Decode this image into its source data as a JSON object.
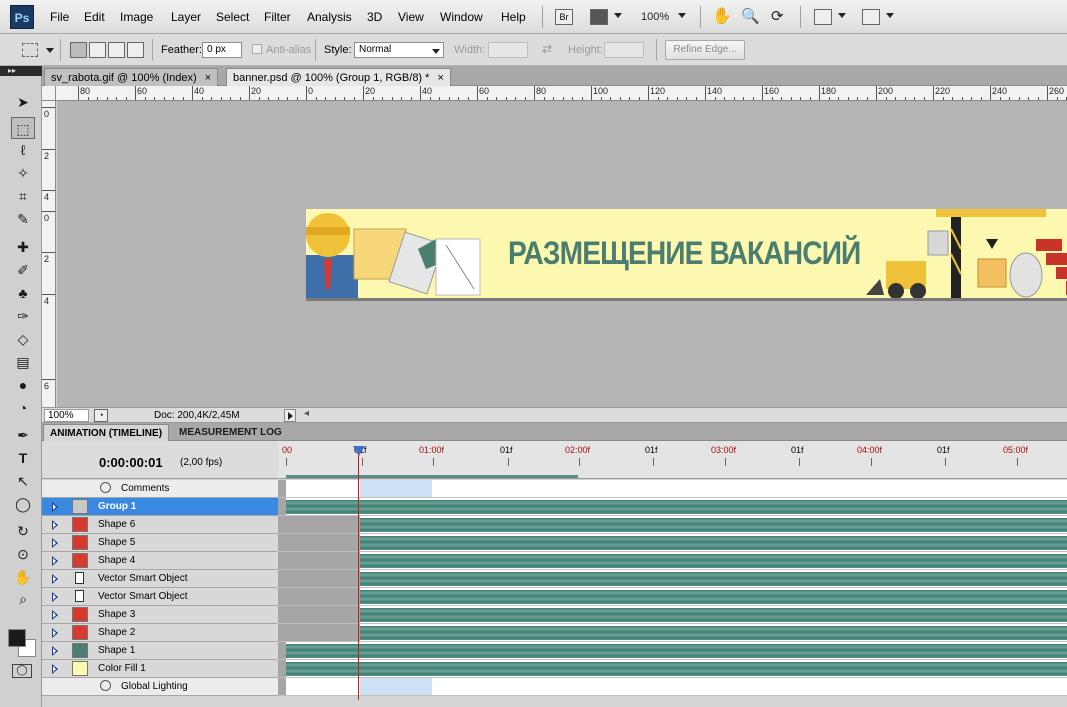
{
  "app": {
    "logo": "Ps",
    "accent": "#3a89e0"
  },
  "menu": [
    "File",
    "Edit",
    "Image",
    "Layer",
    "Select",
    "Filter",
    "Analysis",
    "3D",
    "View",
    "Window",
    "Help"
  ],
  "menubar_tools": {
    "bridge_label": "Br",
    "zoom": "100%"
  },
  "options": {
    "feather_label": "Feather:",
    "feather_value": "0 px",
    "antialias_label": "Anti-alias",
    "style_label": "Style:",
    "style_value": "Normal",
    "width_label": "Width:",
    "height_label": "Height:",
    "refine_label": "Refine Edge..."
  },
  "tabs": [
    {
      "label": "sv_rabota.gif @ 100% (Index)",
      "close": "×"
    },
    {
      "label": "banner.psd @ 100% (Group 1, RGB/8) *",
      "close": "×"
    }
  ],
  "ruler_h": [
    "80",
    "60",
    "40",
    "20",
    "0",
    "20",
    "40",
    "60",
    "80",
    "100",
    "120",
    "140",
    "160",
    "180",
    "200",
    "220",
    "240",
    "260"
  ],
  "ruler_v": [
    "0",
    "2",
    "4",
    "0",
    "2",
    "4",
    "6"
  ],
  "banner": {
    "text": "РАЗМЕЩЕНИЕ ВАКАНСИЙ",
    "text_color": "#4b7d70",
    "bg": "#fdf8b0"
  },
  "status": {
    "zoom": "100%",
    "doc": "Doc: 200,4K/2,45M"
  },
  "panel_tabs": [
    "ANIMATION (TIMELINE)",
    "MEASUREMENT LOG"
  ],
  "timeline": {
    "time": "0:00:00:01",
    "fps": "(2,00 fps)",
    "ruler_labels": [
      {
        "text": "00",
        "red": true
      },
      {
        "text": "01f",
        "red": false
      },
      {
        "text": "01:00f",
        "red": true
      },
      {
        "text": "01f",
        "red": false
      },
      {
        "text": "02:00f",
        "red": true
      },
      {
        "text": "01f",
        "red": false
      },
      {
        "text": "03:00f",
        "red": true
      },
      {
        "text": "01f",
        "red": false
      },
      {
        "text": "04:00f",
        "red": true
      },
      {
        "text": "01f",
        "red": false
      },
      {
        "text": "05:00f",
        "red": true
      }
    ]
  },
  "layers": [
    {
      "label": "Comments",
      "type": "meta"
    },
    {
      "label": "Group 1",
      "type": "group",
      "selected": true,
      "color": "#c8c8c8"
    },
    {
      "label": "Shape 6",
      "type": "shape",
      "color": "#d63a2e"
    },
    {
      "label": "Shape 5",
      "type": "shape",
      "color": "#d63a2e"
    },
    {
      "label": "Shape 4",
      "type": "shape",
      "color": "#d63a2e"
    },
    {
      "label": "Vector Smart Object",
      "type": "smart",
      "color": "#e8e8e8"
    },
    {
      "label": "Vector Smart Object",
      "type": "smart",
      "color": "#e8e8e8"
    },
    {
      "label": "Shape 3",
      "type": "shape",
      "color": "#d63a2e"
    },
    {
      "label": "Shape 2",
      "type": "shape",
      "color": "#d63a2e"
    },
    {
      "label": "Shape 1",
      "type": "shape",
      "color": "#4b7d70"
    },
    {
      "label": "Color Fill 1",
      "type": "fill",
      "color": "#fdf8b0"
    },
    {
      "label": "Global Lighting",
      "type": "meta"
    }
  ]
}
